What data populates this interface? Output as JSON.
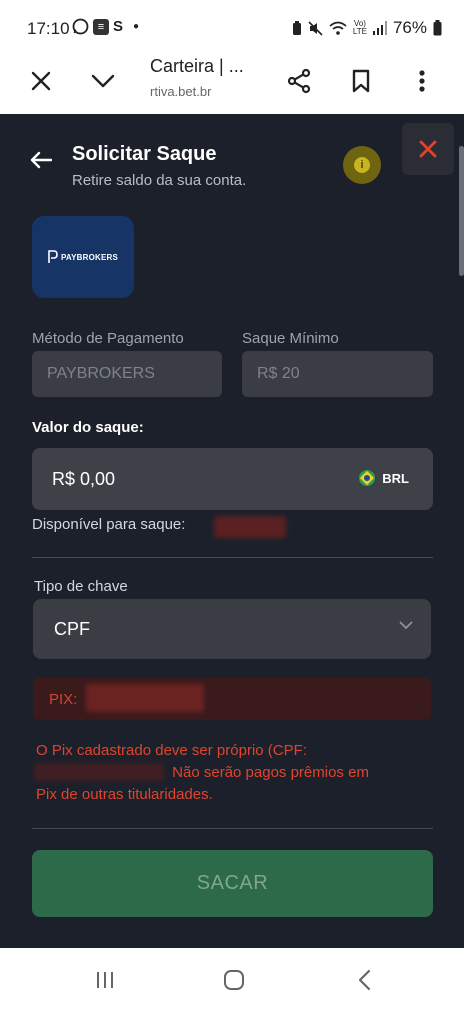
{
  "status_bar": {
    "time": "17:10",
    "left_icons": [
      "whatsapp-icon",
      "app-icon",
      "s-icon",
      "dot-icon"
    ],
    "right_icons": [
      "battery-saver-icon",
      "mute-icon",
      "wifi-icon",
      "volte-icon",
      "signal-icon",
      "battery-icon"
    ],
    "battery_percent": "76%",
    "volte_label_top": "Vo)",
    "volte_label_bottom": "LTE",
    "s_letter": "S"
  },
  "browser": {
    "title": "Carteira | ...",
    "url": "rtiva.bet.br"
  },
  "modal": {
    "title": "Solicitar Saque",
    "subtitle": "Retire saldo da sua conta.",
    "info_glyph": "i",
    "logo_text": "PAYBROKERS"
  },
  "form": {
    "payment_method_label": "Método de Pagamento",
    "payment_method_value": "PAYBROKERS",
    "min_withdraw_label": "Saque Mínimo",
    "min_withdraw_value": "R$ 20",
    "amount_label": "Valor do saque:",
    "amount_value": "R$ 0,00",
    "currency": "BRL",
    "available_label": "Disponível para saque:",
    "key_type_label": "Tipo de chave",
    "key_type_value": "CPF",
    "pix_label": "PIX:",
    "warning_part1": "O Pix cadastrado deve ser próprio (CPF:",
    "warning_part2": "Não serão pagos prêmios em",
    "warning_part3": "Pix de outras titularidades.",
    "submit_label": "SACAR"
  },
  "colors": {
    "background": "#1c202b",
    "submit": "#2d6a4a",
    "warning": "#e0442d",
    "close": "#e8412a",
    "info": "#c9b320"
  }
}
